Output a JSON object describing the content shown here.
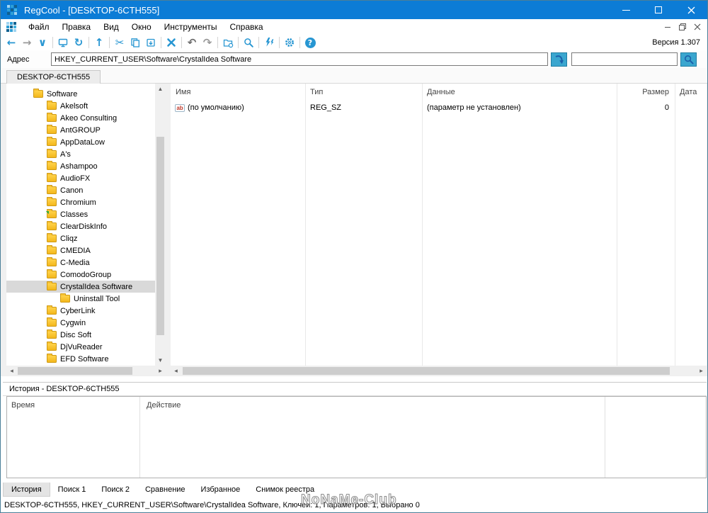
{
  "window": {
    "title": "RegCool - [DESKTOP-6CTH555]",
    "version_label": "Версия 1.307"
  },
  "menu": {
    "items": [
      "Файл",
      "Правка",
      "Вид",
      "Окно",
      "Инструменты",
      "Справка"
    ]
  },
  "toolbar": {
    "icons": [
      "back",
      "forward",
      "expand",
      "sep",
      "computer",
      "refresh",
      "sep",
      "up",
      "sep",
      "cut",
      "copy",
      "paste",
      "sep",
      "delete",
      "sep",
      "undo",
      "redo",
      "sep",
      "new-key",
      "sep",
      "search",
      "sep",
      "compare",
      "sep",
      "settings",
      "sep",
      "help"
    ]
  },
  "address_bar": {
    "label": "Адрес",
    "value": "HKEY_CURRENT_USER\\Software\\CrystalIdea Software",
    "quick_search_value": ""
  },
  "session_tabs": [
    "DESKTOP-6CTH555"
  ],
  "tree": {
    "items": [
      {
        "label": "Software",
        "level": 0
      },
      {
        "label": "Akelsoft",
        "level": 1
      },
      {
        "label": "Akeo Consulting",
        "level": 1
      },
      {
        "label": "AntGROUP",
        "level": 1
      },
      {
        "label": "AppDataLow",
        "level": 1
      },
      {
        "label": "A's",
        "level": 1
      },
      {
        "label": "Ashampoo",
        "level": 1
      },
      {
        "label": "AudioFX",
        "level": 1
      },
      {
        "label": "Canon",
        "level": 1
      },
      {
        "label": "Chromium",
        "level": 1
      },
      {
        "label": "Classes",
        "level": 1,
        "shared": true
      },
      {
        "label": "ClearDiskInfo",
        "level": 1
      },
      {
        "label": "Cliqz",
        "level": 1
      },
      {
        "label": "CMEDIA",
        "level": 1
      },
      {
        "label": "C-Media",
        "level": 1
      },
      {
        "label": "ComodoGroup",
        "level": 1
      },
      {
        "label": "CrystalIdea Software",
        "level": 1,
        "selected": true
      },
      {
        "label": "Uninstall Tool",
        "level": 2
      },
      {
        "label": "CyberLink",
        "level": 1
      },
      {
        "label": "Cygwin",
        "level": 1
      },
      {
        "label": "Disc Soft",
        "level": 1
      },
      {
        "label": "DjVuReader",
        "level": 1
      },
      {
        "label": "EFD Software",
        "level": 1
      }
    ]
  },
  "list": {
    "columns": [
      "Имя",
      "Тип",
      "Данные",
      "Размер",
      "Дата"
    ],
    "rows": [
      {
        "name": "(по умолчанию)",
        "type": "REG_SZ",
        "data": "(параметр не установлен)",
        "size": "0",
        "date": ""
      }
    ]
  },
  "history_panel": {
    "title": "История - DESKTOP-6CTH555",
    "columns": [
      "Время",
      "Действие"
    ]
  },
  "bottom_tabs": {
    "active": "История",
    "items": [
      "История",
      "Поиск 1",
      "Поиск 2",
      "Сравнение",
      "Избранное",
      "Снимок реестра"
    ]
  },
  "status_bar": {
    "text": "DESKTOP-6CTH555, HKEY_CURRENT_USER\\Software\\CrystalIdea Software, Ключей: 1, Параметров: 1, Выбрано 0",
    "watermark": "NoNaMe-Club"
  },
  "colors": {
    "titlebar": "#0c7cd6",
    "icon_blue": "#2796d2",
    "icon_gray": "#9a9a9a",
    "button_teal": "#3aa6cf",
    "folder_yellow": "#f3b71c",
    "selection_gray": "#d9d9d9",
    "window_border": "#4a7f99"
  }
}
